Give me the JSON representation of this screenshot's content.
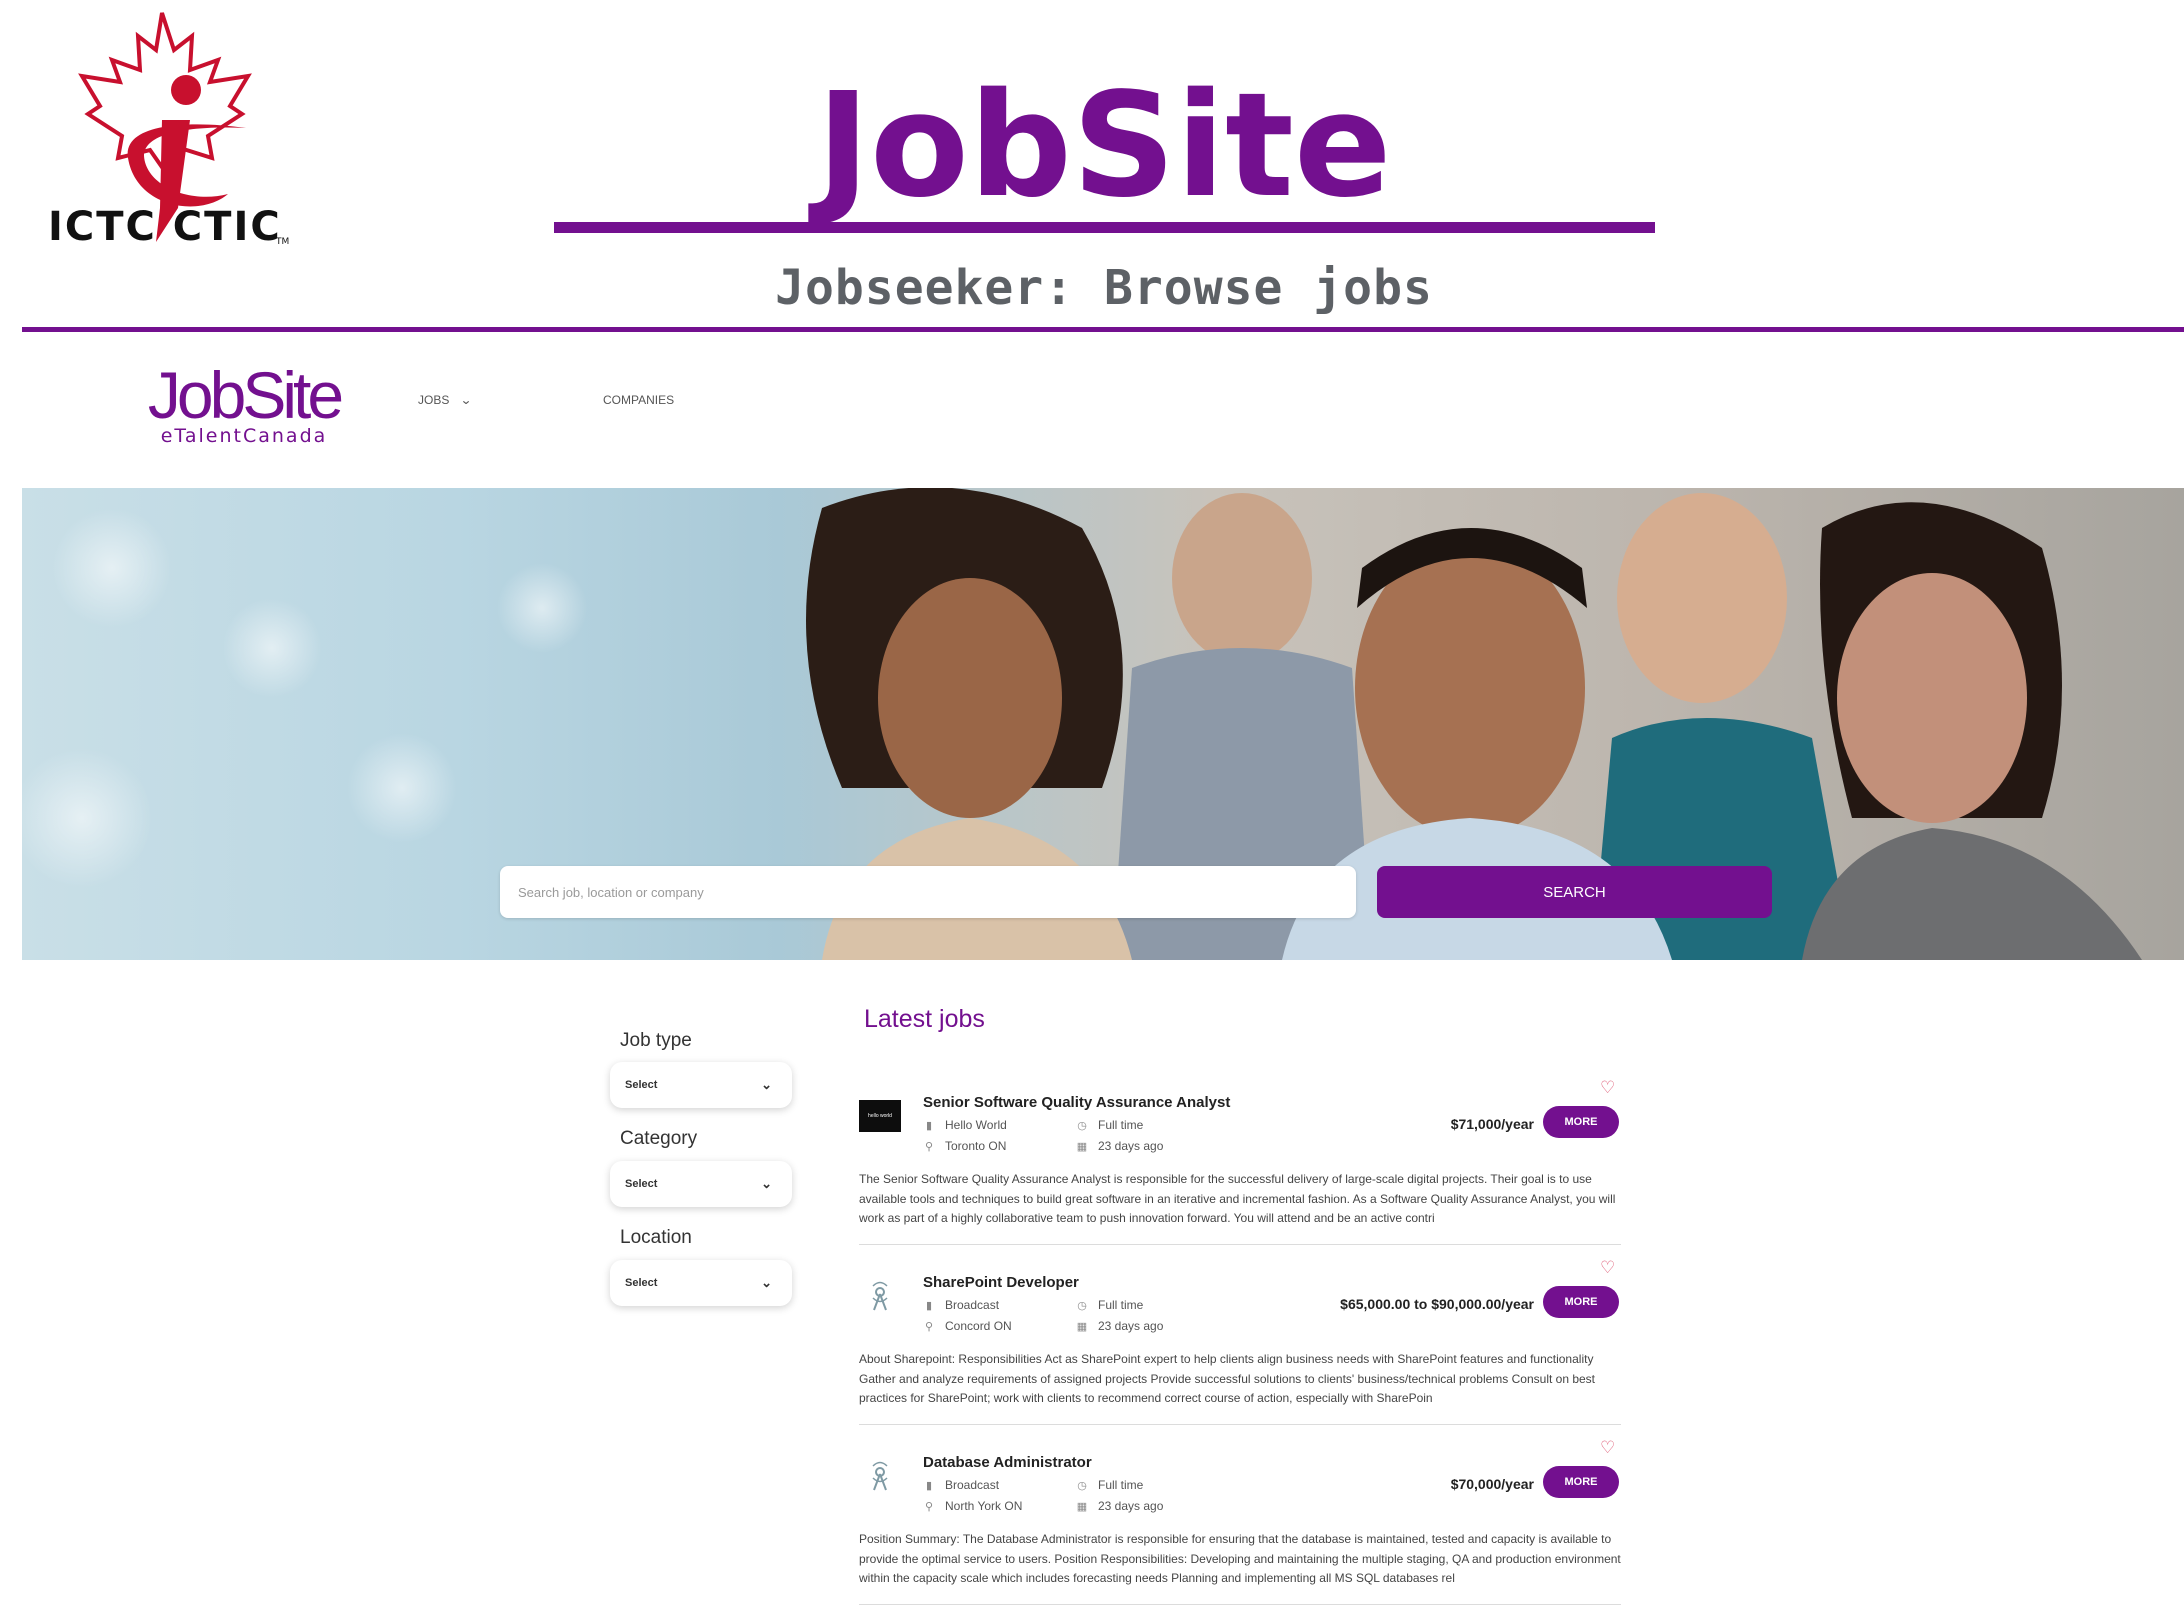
{
  "slide": {
    "logo_text": "ICTC CTIC",
    "title": "JobSite",
    "subtitle": "Jobseeker: Browse jobs"
  },
  "site": {
    "logo_word": "JobSite",
    "logo_tagline": "eTalentCanada",
    "nav": {
      "jobs": "JOBS",
      "companies": "COMPANIES"
    },
    "brand_color": "#73108f"
  },
  "hero": {
    "search_placeholder": "Search job, location or company",
    "search_button": "SEARCH"
  },
  "filters": [
    {
      "label": "Job type",
      "value": "Select"
    },
    {
      "label": "Category",
      "value": "Select"
    },
    {
      "label": "Location",
      "value": "Select"
    }
  ],
  "jobs_section": {
    "title": "Latest jobs",
    "more_label": "MORE",
    "jobs": [
      {
        "title": "Senior Software Quality Assurance Analyst",
        "company": "Hello World",
        "location": "Toronto ON",
        "type": "Full time",
        "posted": "23 days ago",
        "salary": "$71,000/year",
        "logo_text": "hello world",
        "description": "The Senior Software Quality Assurance Analyst is responsible for the successful delivery of large-scale digital projects. Their goal is to use available tools and techniques to build great software in an iterative and incremental fashion. As a Software Quality Assurance Analyst, you will work as part of a highly collaborative team to push innovation forward. You will attend and be an active contri"
      },
      {
        "title": "SharePoint Developer",
        "company": "Broadcast",
        "location": "Concord ON",
        "type": "Full time",
        "posted": "23 days ago",
        "salary": "$65,000.00 to $90,000.00/year",
        "description": "About Sharepoint: Responsibilities Act as SharePoint expert to help clients align business needs with SharePoint features and functionality Gather and analyze requirements of assigned projects Provide successful solutions to clients' business/technical problems Consult on best practices for SharePoint; work with clients to recommend correct course of action, especially with SharePoin"
      },
      {
        "title": "Database Administrator",
        "company": "Broadcast",
        "location": "North York ON",
        "type": "Full time",
        "posted": "23 days ago",
        "salary": "$70,000/year",
        "description": "Position Summary: The Database Administrator is responsible for ensuring that the database is maintained, tested and capacity is available to provide the optimal service to users. Position Responsibilities: Developing and maintaining the multiple staging, QA and production environment within the capacity scale which includes forecasting needs Planning and implementing all MS SQL databases rel"
      }
    ]
  }
}
